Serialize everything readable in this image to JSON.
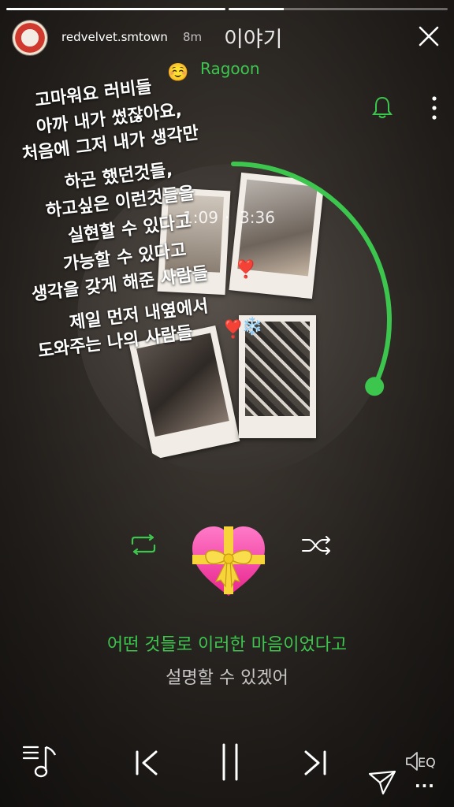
{
  "story": {
    "username": "redvelvet.smtown",
    "posted_ago": "8m",
    "progress_segments": [
      1.0,
      0.25
    ]
  },
  "player": {
    "song_title": "이야기",
    "artist": "Ragoon",
    "elapsed": "1:09",
    "separator": "·",
    "total": "3:36",
    "playback_progress": 0.32
  },
  "caption": {
    "lines": [
      "고마워요 러비들",
      "아까 내가 썼잖아요,",
      "처음에 그저 내가 생각만",
      "하곤 했던것들,",
      "하고싶은 이런것들을",
      "실현할 수 있다고",
      "가능할 수 있다고",
      "생각을 갖게 해준 사람들",
      "제일 먼저 내옆에서",
      "도와주는 나의 사람들"
    ],
    "emojis": [
      "☺️",
      "❣️",
      "❣️",
      "❄️"
    ]
  },
  "lyrics": {
    "current": "어떤 것들로 이러한 마음이었다고",
    "next": "설명할 수 있겠어"
  },
  "colors": {
    "accent": "#3cc64e",
    "text": "#ffffff"
  },
  "icons": {
    "close": "close-icon",
    "bell": "bell-icon",
    "more": "more-vertical-icon",
    "repeat": "repeat-icon",
    "shuffle": "shuffle-icon",
    "heart": "heart-with-ribbon-icon",
    "playlist": "playlist-icon",
    "prev": "previous-track-icon",
    "pause": "pause-icon",
    "next": "next-track-icon",
    "eq": "equalizer-icon",
    "send": "send-icon",
    "more_h": "more-horizontal-icon"
  },
  "labels": {
    "eq": "EQ",
    "more": "..."
  }
}
